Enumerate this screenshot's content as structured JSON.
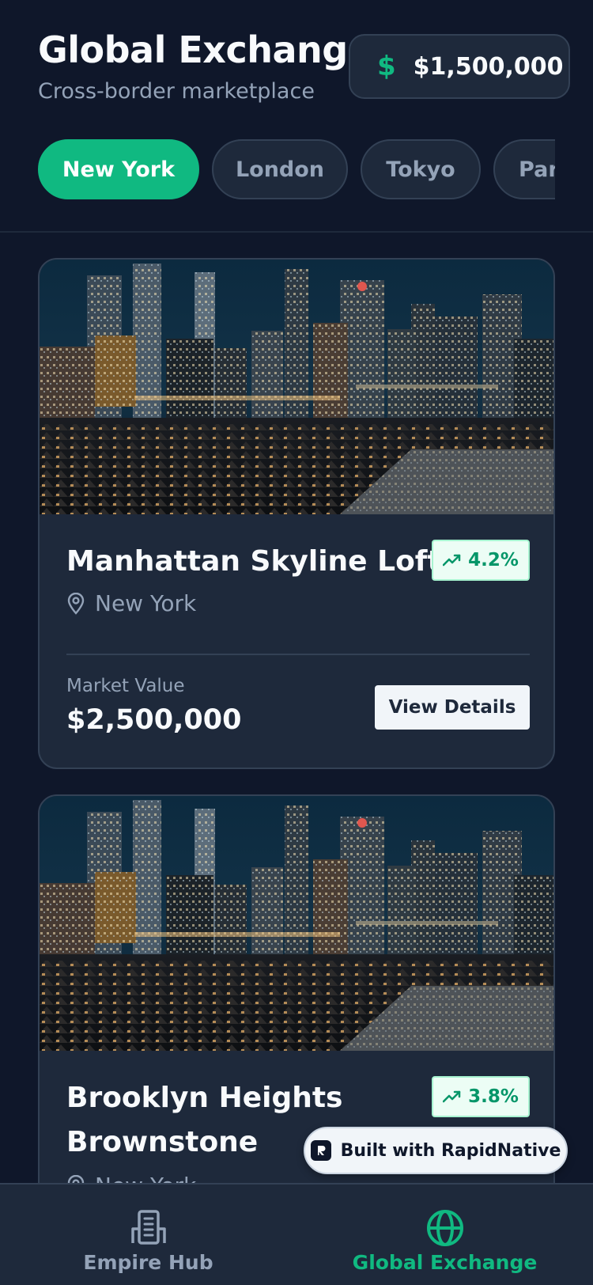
{
  "header": {
    "title": "Global Exchange",
    "subtitle": "Cross-border marketplace",
    "balance": {
      "symbol": "$",
      "amount": "$1,500,000"
    }
  },
  "cities": [
    {
      "label": "New York",
      "active": true
    },
    {
      "label": "London",
      "active": false
    },
    {
      "label": "Tokyo",
      "active": false
    },
    {
      "label": "Paris",
      "active": false
    }
  ],
  "listings": [
    {
      "title": "Manhattan Skyline Loft",
      "trend": "4.2%",
      "location": "New York",
      "market_value_label": "Market Value",
      "market_value": "$2,500,000",
      "action_label": "View Details",
      "image": "night-city-skyline-photo"
    },
    {
      "title": "Brooklyn Heights Brownstone",
      "trend": "3.8%",
      "location": "New York",
      "image": "night-city-skyline-photo"
    }
  ],
  "badge": {
    "label": "Built with RapidNative"
  },
  "bottom_nav": [
    {
      "label": "Empire Hub",
      "icon": "building-icon",
      "active": false
    },
    {
      "label": "Global Exchange",
      "icon": "globe-icon",
      "active": true
    }
  ],
  "colors": {
    "background": "#0f172a",
    "surface": "#1e293b",
    "accent": "#10b981",
    "text_muted": "#94a3b8"
  }
}
